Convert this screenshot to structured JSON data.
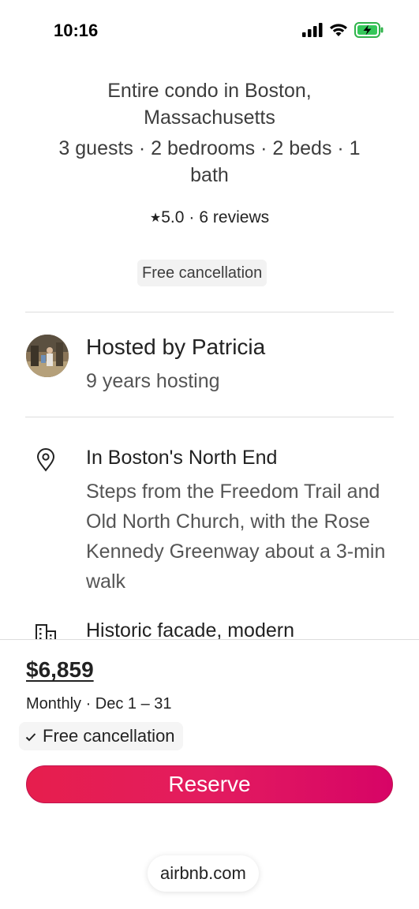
{
  "status_bar": {
    "time": "10:16",
    "icons": [
      "signal-icon",
      "wifi-icon",
      "battery-charging-icon"
    ]
  },
  "listing": {
    "title": "Entire condo in Boston, Massachusetts",
    "facts": "3 guests · 2 bedrooms · 2 beds · 1 bath",
    "rating": "5.0",
    "reviews": "6 reviews",
    "cancellation_badge": "Free cancellation"
  },
  "host": {
    "name": "Hosted by Patricia",
    "years": "9 years hosting"
  },
  "highlights": [
    {
      "icon": "map-pin-icon",
      "title": "In Boston's North End",
      "description": "Steps from the Freedom Trail and Old North Church, with the Rose Kennedy Greenway about a 3-min walk"
    },
    {
      "icon": "building-icon",
      "title": "Historic facade, modern",
      "description": ""
    }
  ],
  "booking": {
    "price": "$6,859",
    "period": "Monthly · Dec 1 – 31",
    "cancellation": "Free cancellation",
    "reserve_label": "Reserve"
  },
  "browser": {
    "url": "airbnb.com"
  },
  "colors": {
    "accent": "#e31c5f",
    "text": "#222222",
    "muted": "#555555"
  }
}
